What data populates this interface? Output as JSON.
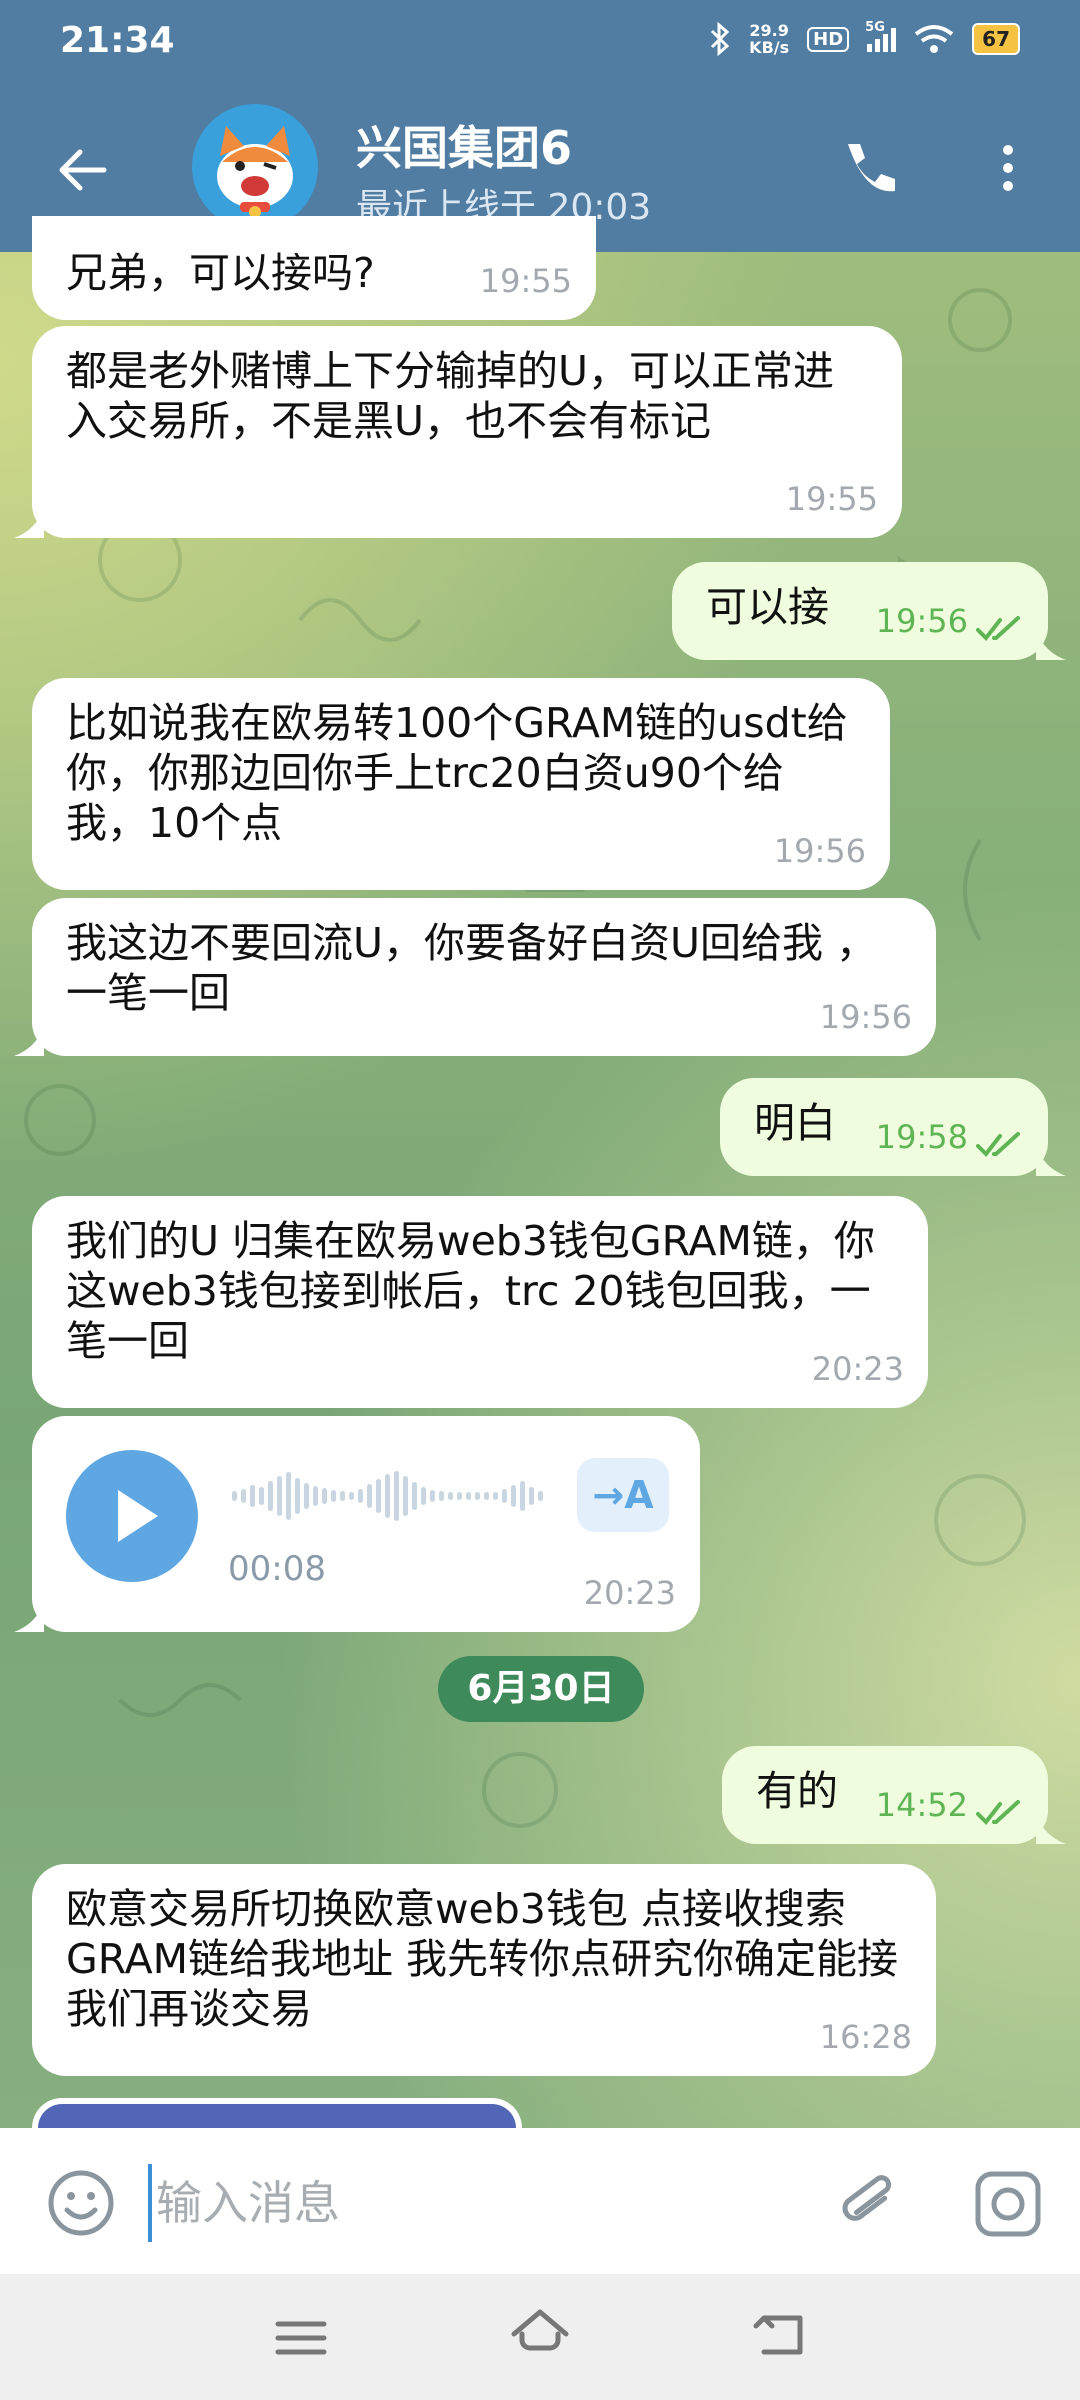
{
  "status_bar": {
    "time": "21:34",
    "net_speed_value": "29.9",
    "net_speed_unit": "KB/s",
    "hd_label": "HD",
    "network_type": "5G",
    "battery_level": "67",
    "icons": [
      "bluetooth-icon",
      "hd-icon",
      "signal-icon",
      "wifi-icon",
      "battery-icon"
    ]
  },
  "header": {
    "title": "兴国集团6",
    "subtitle": "最近上线于 20:03",
    "icons": [
      "back-arrow-icon",
      "phone-icon",
      "more-vertical-icon"
    ],
    "color": "#517da2"
  },
  "messages": [
    {
      "direction": "in",
      "text": "兄弟，可以接吗?",
      "time": "19:55"
    },
    {
      "direction": "in",
      "text": "都是老外赌博上下分输掉的U，可以正常进入交易所，不是黑U，也不会有标记",
      "time": "19:55"
    },
    {
      "direction": "out",
      "text": "可以接",
      "time": "19:56",
      "read": true
    },
    {
      "direction": "in",
      "text": "比如说我在欧易转100个GRAM链的usdt给你，你那边回你手上trc20白资u90个给我，10个点",
      "time": "19:56"
    },
    {
      "direction": "in",
      "text": "我这边不要回流U，你要备好白资U回给我 ，一笔一回",
      "time": "19:56"
    },
    {
      "direction": "out",
      "text": "明白",
      "time": "19:58",
      "read": true
    },
    {
      "direction": "in",
      "text": "我们的U 归集在欧易web3钱包GRAM链，你这web3钱包接到帐后，trc 20钱包回我，一笔一回",
      "time": "20:23"
    },
    {
      "direction": "in",
      "type": "voice",
      "duration": "00:08",
      "transcribe_label": "→A",
      "time": "20:23"
    },
    {
      "direction": "out",
      "text": "有的",
      "time": "14:52",
      "read": true
    },
    {
      "direction": "in",
      "text": "欧意交易所切换欧意web3钱包 点接收搜索GRAM链给我地址 我先转你点研究你确定能接我们再谈交易",
      "time": "16:28"
    }
  ],
  "date_separator": "6月30日",
  "input": {
    "placeholder": "输入消息",
    "icons": [
      "emoji-icon",
      "attach-icon",
      "camera-icon"
    ]
  },
  "nav_bar": {
    "icons": [
      "menu-icon",
      "home-icon",
      "back-icon"
    ]
  },
  "colors": {
    "incoming_bubble": "#ffffff",
    "outgoing_bubble": "#effdde",
    "read_tick": "#5fb454",
    "accent": "#5fa7e3"
  }
}
